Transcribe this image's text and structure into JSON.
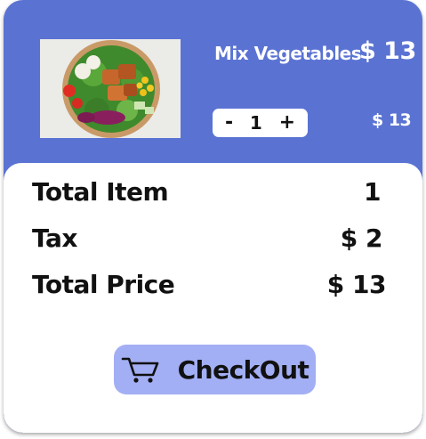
{
  "item": {
    "name": "Mix Vegetables",
    "price": "$ 13",
    "quantity": "1",
    "decrement": "-",
    "increment": "+",
    "line_total": "$ 13",
    "image_icon": "salad-bowl-photo"
  },
  "summary": {
    "total_item_label": "Total Item",
    "total_item_value": "1",
    "tax_label": "Tax",
    "tax_value": "$ 2",
    "total_price_label": "Total Price",
    "total_price_value": "$ 13"
  },
  "checkout": {
    "label": "CheckOut",
    "icon": "cart-icon"
  },
  "colors": {
    "card_background": "#5a73d3",
    "checkout_button": "#a3aff4",
    "text_dark": "#111111",
    "text_light": "#ffffff"
  }
}
